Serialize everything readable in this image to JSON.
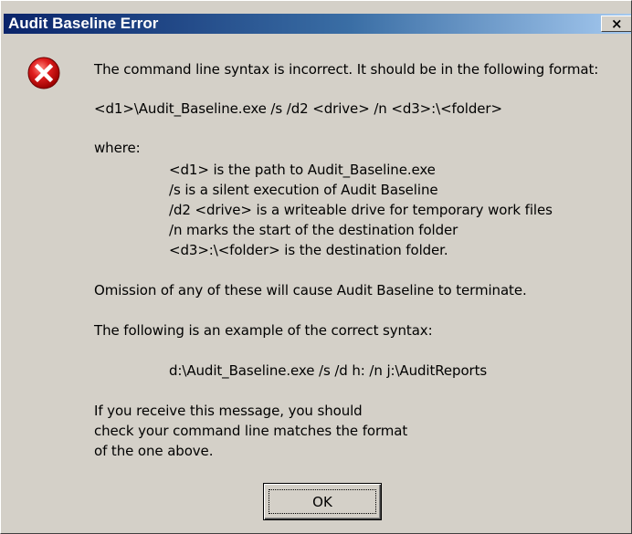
{
  "dialog": {
    "title": "Audit Baseline Error",
    "close_glyph": "×",
    "icon": "error-icon",
    "message": {
      "line1": "The command line syntax is incorrect. It should be in the following format:",
      "format": "<d1>\\Audit_Baseline.exe /s /d2 <drive> /n <d3>:\\<folder>",
      "where": "where:",
      "where_items": [
        "<d1> is the path to Audit_Baseline.exe",
        "/s is a silent execution of Audit Baseline",
        "/d2 <drive> is a writeable drive for temporary work files",
        "/n marks the start of the destination folder",
        "<d3>:\\<folder> is the destination folder."
      ],
      "omission": "Omission of any of these will cause Audit Baseline to terminate.",
      "example_intro": "The following is an example of the correct syntax:",
      "example": "d:\\Audit_Baseline.exe /s /d h: /n j:\\AuditReports",
      "closing": [
        "If you receive this message, you should",
        "check your command line matches the format",
        "of the one above."
      ]
    },
    "ok_label": "OK"
  },
  "colors": {
    "titlebar_start": "#0a246a",
    "titlebar_end": "#a6caf0",
    "dialog_bg": "#d4d0c8",
    "error_red": "#e01f1f"
  }
}
